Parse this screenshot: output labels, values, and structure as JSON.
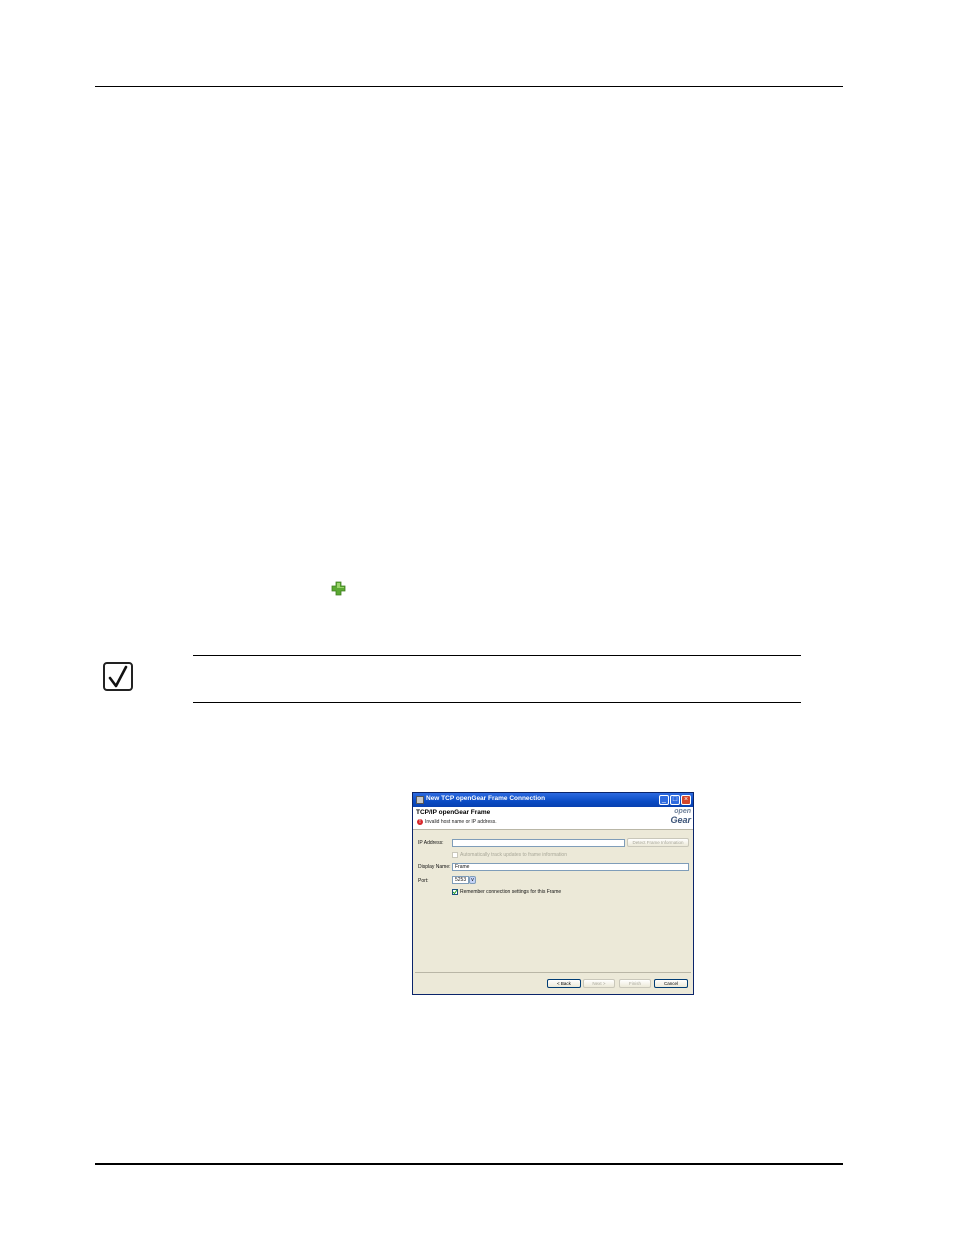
{
  "dialog": {
    "title": "New TCP openGear Frame Connection",
    "header_title": "TCP/IP openGear Frame",
    "error_message": "Invalid host name or IP address.",
    "logo_line1": "open",
    "logo_line2": "Gear",
    "ip_address_label": "IP Address:",
    "ip_address_value": "",
    "detect_button": "Detect Frame Information",
    "auto_track_label": "Automatically track updates to frame information",
    "display_name_label": "Display Name:",
    "display_name_value": "Frame",
    "port_label": "Port:",
    "port_value": "5253",
    "remember_label": "Remember connection settings for this Frame",
    "remember_checked": true,
    "back_button": "< Back",
    "next_button": "Next >",
    "finish_button": "Finish",
    "cancel_button": "Cancel"
  },
  "colors": {
    "titlebar": "#0a4bc4",
    "dialog_bg": "#ece9d8",
    "plus_icon": "#5aa832"
  }
}
